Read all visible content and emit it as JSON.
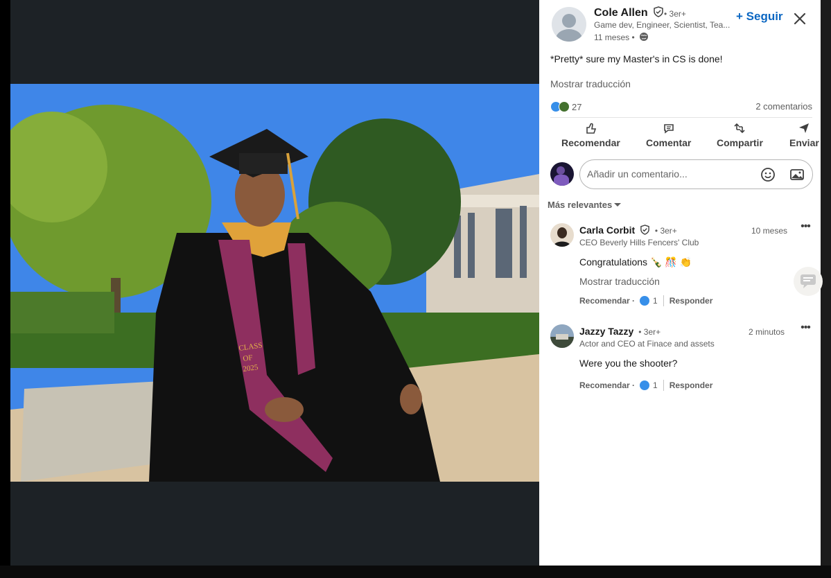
{
  "post": {
    "author": {
      "name": "Cole Allen",
      "degree": "• 3er+",
      "headline": "Game dev, Engineer, Scientist, Tea...",
      "time": "11 meses •"
    },
    "follow_label": "+ Seguir",
    "text": "*Pretty* sure my Master's in CS is done!",
    "translate_label": "Mostrar traducción",
    "reaction_count": "27",
    "comments_count": "2 comentarios"
  },
  "actions": {
    "like": "Recomendar",
    "comment": "Comentar",
    "share": "Compartir",
    "send": "Enviar"
  },
  "comment_box": {
    "placeholder": "Añadir un comentario..."
  },
  "sort_label": "Más relevantes",
  "comments": [
    {
      "name": "Carla Corbit",
      "degree": "• 3er+",
      "headline": "CEO Beverly Hills Fencers' Club",
      "time": "10 meses",
      "text": "Congratulations 🍾 🎊 👏",
      "translate_label": "Mostrar traducción",
      "like_label": "Recomendar ·",
      "like_count": "1",
      "reply_label": "Responder"
    },
    {
      "name": "Jazzy Tazzy",
      "degree": "• 3er+",
      "headline": "Actor and CEO at Finace and assets",
      "time": "2 minutos",
      "text": "Were you the shooter?",
      "like_label": "Recomendar ·",
      "like_count": "1",
      "reply_label": "Responder"
    }
  ],
  "photo": {
    "gown_text_1": "CLASS",
    "gown_text_2": "OF",
    "gown_text_3": "2025"
  },
  "colors": {
    "link_blue": "#0a66c2",
    "viewer_bg": "#1d2226",
    "stole": "#8e2f5f",
    "gold": "#d9a23b"
  },
  "icons": [
    "verified-icon",
    "globe-icon",
    "close-icon",
    "like-icon",
    "comment-icon",
    "repost-icon",
    "send-icon",
    "emoji-icon",
    "image-icon",
    "more-icon",
    "chat-icon"
  ]
}
